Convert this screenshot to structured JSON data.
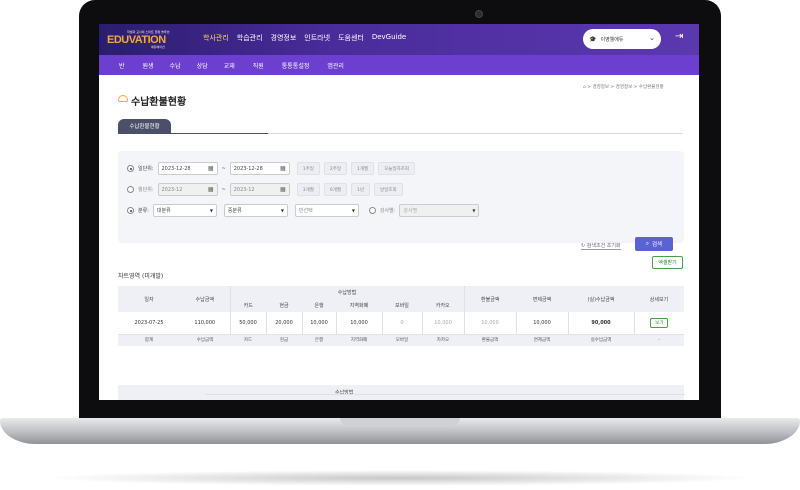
{
  "header": {
    "logo_tagline": "학생과 교사의 스마트 행정 솔루션",
    "logo_text": "EDUVATION",
    "logo_sub": "에듀베이션",
    "nav": [
      "학사관리",
      "학습관리",
      "경영정보",
      "인트라넷",
      "도움센터",
      "DevGuide"
    ],
    "active_nav": "학사관리",
    "user_select": "이영웰에듀",
    "user_icon": "graduation-cap-icon",
    "logout_icon": "logout-icon"
  },
  "subnav": [
    "반",
    "원생",
    "수납",
    "상담",
    "교재",
    "직원",
    "통통통설정",
    "앱관리"
  ],
  "breadcrumb": "⌂ > 경영정보 > 경영정보 > 수납환불현황",
  "page": {
    "title": "수납환불현황",
    "tab": "수납환불현황"
  },
  "filter": {
    "row1": {
      "label": "일단위:",
      "from": "2023-12-28",
      "to": "2023-12-28",
      "buttons": [
        "1주일",
        "2주일",
        "1개월",
        "오늘일자조회"
      ]
    },
    "row2": {
      "label": "월단위:",
      "from": "2023-12",
      "to": "2023-12",
      "buttons": [
        "3개월",
        "6개월",
        "1년",
        "날일조회"
      ]
    },
    "row3": {
      "label": "분류:",
      "cat1": "대분류",
      "cat2": "중분류",
      "cat3": "반선택",
      "teacher_label": "강사별:",
      "teacher": "강사명"
    },
    "reset": "검색조건 초기화",
    "search": "검색",
    "tilde": "~"
  },
  "excel_button": "엑셀받기",
  "chart_label": "차트영역 (미개발)",
  "table": {
    "headers_top": {
      "date": "일자",
      "total": "수납금액",
      "method": "수납방법",
      "refund": "환불금액",
      "discount": "면제금액",
      "actual": "(실)수납금액",
      "detail": "상세보기"
    },
    "headers_sub": [
      "카드",
      "현금",
      "은행",
      "지역화폐",
      "모바일",
      "카카오"
    ],
    "row": {
      "date": "2023-07-25",
      "total": "110,000",
      "card": "50,000",
      "cash": "20,000",
      "bank": "10,000",
      "local": "10,000",
      "mobile": "0",
      "kakao": "10,000",
      "refund": "10,000",
      "discount": "10,000",
      "actual": "90,000",
      "view": "보기"
    },
    "footer": {
      "label": "합계",
      "total": "수납금액",
      "card": "카드",
      "cash": "현금",
      "bank": "은행",
      "local": "지역화폐",
      "mobile": "모바일",
      "kakao": "카카오",
      "refund": "환불금액",
      "discount": "면제금액",
      "actual": "실수납금액",
      "detail": "-"
    }
  },
  "table2": {
    "header": "수납방법"
  }
}
